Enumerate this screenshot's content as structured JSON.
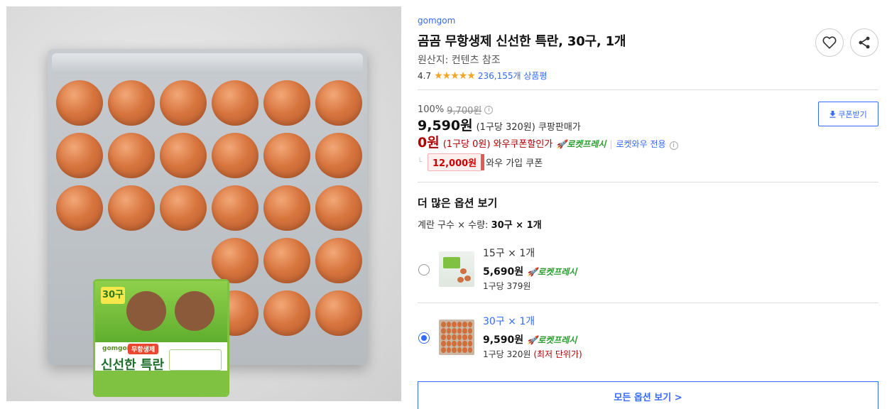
{
  "product": {
    "brand": "gomgom",
    "title": "곰곰 무항생제 신선한 특란, 30구, 1개",
    "origin": "원산지: 컨텐츠 참조",
    "rating": "4.7",
    "stars": "★★★★★",
    "review_count": "236,155개 상품평"
  },
  "image_label": {
    "count": "30구",
    "brand": "gomgom",
    "ribbon": "무항생제",
    "title": "신선한 특란"
  },
  "pricing": {
    "discount_rate": "100%",
    "original_price": "9,700원",
    "info_icon": "info-icon",
    "sale_price": "9,590원",
    "sale_unit": "(1구당 320원) 쿠팡판매가",
    "coupon_price": "0원",
    "coupon_unit": "(1구당 0원) 와우쿠폰할인가",
    "rocket_fresh": "로켓프레시",
    "separator": "|",
    "rocket_wow": "로켓와우 전용",
    "wow_amount": "12,000원",
    "wow_label": "와우 가입 쿠폰",
    "coupon_button": "쿠폰받기",
    "corner_mark": "└"
  },
  "options": {
    "heading": "더 많은 옵션 보기",
    "summary_label": "계란 구수 × 수량:",
    "summary_value": "30구 × 1개",
    "items": [
      {
        "name": "15구 × 1개",
        "price": "5,690원",
        "badge": "로켓프레시",
        "unit": "1구당 379원",
        "selected": false
      },
      {
        "name": "30구 × 1개",
        "price": "9,590원",
        "badge": "로켓프레시",
        "unit": "1구당 320원",
        "lowest": "(최저 단위가)",
        "selected": true
      }
    ],
    "all_button": "모든 옵션 보기 >"
  },
  "colors": {
    "accent_blue": "#346aff",
    "price_red": "#ae0000",
    "rocket_green": "#2b9d2f"
  }
}
